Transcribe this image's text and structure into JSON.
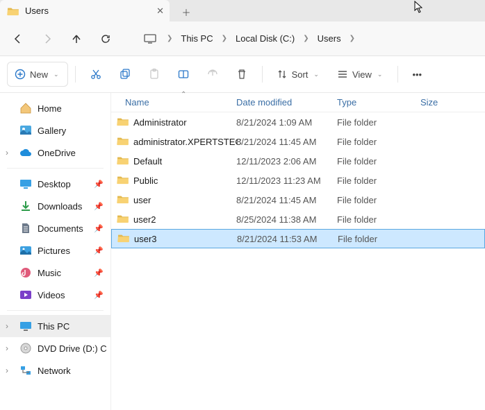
{
  "tab": {
    "title": "Users"
  },
  "breadcrumb": {
    "pc": "This PC",
    "disk": "Local Disk (C:)",
    "folder": "Users"
  },
  "toolbar": {
    "new": "New",
    "sort": "Sort",
    "view": "View"
  },
  "sidebar": {
    "home": "Home",
    "gallery": "Gallery",
    "onedrive": "OneDrive",
    "desktop": "Desktop",
    "downloads": "Downloads",
    "documents": "Documents",
    "pictures": "Pictures",
    "music": "Music",
    "videos": "Videos",
    "thispc": "This PC",
    "dvd": "DVD Drive (D:) CCC",
    "network": "Network"
  },
  "columns": {
    "name": "Name",
    "date": "Date modified",
    "type": "Type",
    "size": "Size"
  },
  "rows": [
    {
      "name": "Administrator",
      "date": "8/21/2024 1:09 AM",
      "type": "File folder"
    },
    {
      "name": "administrator.XPERTSTEC",
      "date": "8/21/2024 11:45 AM",
      "type": "File folder"
    },
    {
      "name": "Default",
      "date": "12/11/2023 2:06 AM",
      "type": "File folder"
    },
    {
      "name": "Public",
      "date": "12/11/2023 11:23 AM",
      "type": "File folder"
    },
    {
      "name": "user",
      "date": "8/21/2024 11:45 AM",
      "type": "File folder"
    },
    {
      "name": "user2",
      "date": "8/25/2024 11:38 AM",
      "type": "File folder"
    },
    {
      "name": "user3",
      "date": "8/21/2024 11:53 AM",
      "type": "File folder"
    }
  ]
}
